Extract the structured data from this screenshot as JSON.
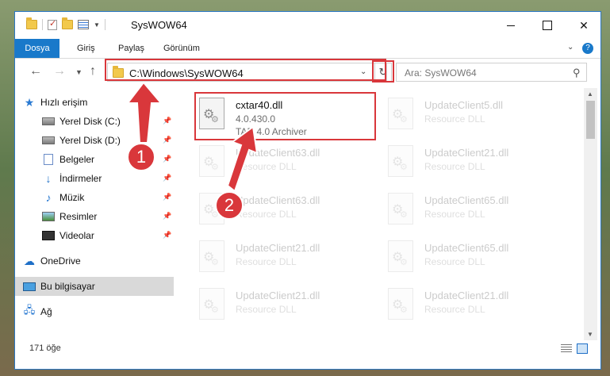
{
  "window": {
    "title": "SysWOW64",
    "controls": {
      "minimize": "—",
      "maximize": "",
      "close": "✕"
    }
  },
  "ribbon": {
    "tabs": [
      "Dosya",
      "Giriş",
      "Paylaş",
      "Görünüm"
    ],
    "help": "?"
  },
  "navigation": {
    "address": "C:\\Windows\\SysWOW64",
    "search_placeholder": "Ara: SysWOW64"
  },
  "sidebar": {
    "items": [
      {
        "label": "Hızlı erişim",
        "icon": "star-icon"
      },
      {
        "label": "Yerel Disk (C:)",
        "icon": "drive-icon",
        "pinned": true
      },
      {
        "label": "Yerel Disk (D:)",
        "icon": "drive-icon",
        "pinned": true
      },
      {
        "label": "Belgeler",
        "icon": "documents-icon",
        "pinned": true
      },
      {
        "label": "İndirmeler",
        "icon": "downloads-icon",
        "pinned": true
      },
      {
        "label": "Müzik",
        "icon": "music-icon",
        "pinned": true
      },
      {
        "label": "Resimler",
        "icon": "pictures-icon",
        "pinned": true
      },
      {
        "label": "Videolar",
        "icon": "videos-icon",
        "pinned": true
      },
      {
        "label": "OneDrive",
        "icon": "cloud-icon"
      },
      {
        "label": "Bu bilgisayar",
        "icon": "computer-icon",
        "selected": true
      },
      {
        "label": "Ağ",
        "icon": "network-icon"
      }
    ]
  },
  "files": {
    "highlighted": {
      "name": "cxtar40.dll",
      "version": "4.0.430.0",
      "description": "TAR 4.0 Archiver"
    },
    "column1": [
      {
        "name": "UpdateClient63.dll",
        "type": "Resource DLL"
      },
      {
        "name": "UpdateClient63.dll",
        "type": "Resource DLL"
      },
      {
        "name": "UpdateClient21.dll",
        "type": "Resource DLL"
      },
      {
        "name": "UpdateClient21.dll",
        "type": "Resource DLL"
      }
    ],
    "column2": [
      {
        "name": "UpdateClient5.dll",
        "type": "Resource DLL"
      },
      {
        "name": "UpdateClient21.dll",
        "type": "Resource DLL"
      },
      {
        "name": "UpdateClient65.dll",
        "type": "Resource DLL"
      },
      {
        "name": "UpdateClient65.dll",
        "type": "Resource DLL"
      },
      {
        "name": "UpdateClient21.dll",
        "type": "Resource DLL"
      }
    ]
  },
  "status": {
    "item_count": "171 öğe"
  },
  "callouts": {
    "step1": "1",
    "step2": "2"
  },
  "colors": {
    "accent": "#1979ca",
    "highlight": "#d9373b"
  }
}
